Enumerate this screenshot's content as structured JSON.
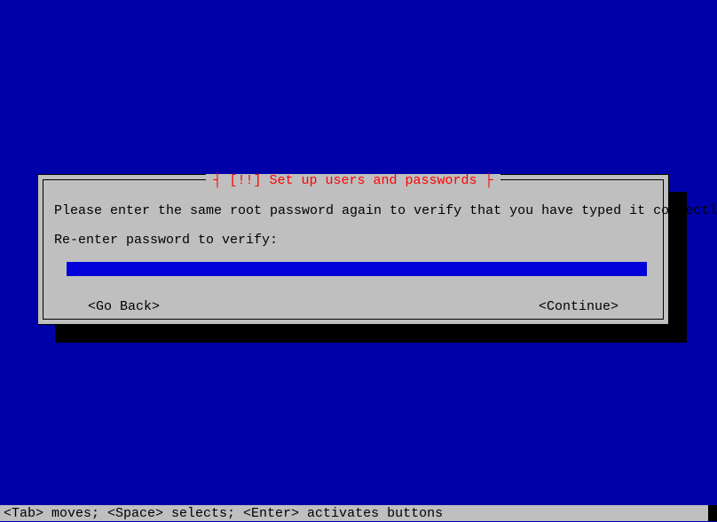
{
  "dialog": {
    "title_prefix": "┤ ",
    "title": "[!!] Set up users and passwords",
    "title_suffix": " ├",
    "instruction": "Please enter the same root password again to verify that you have typed it correctly.",
    "prompt": "Re-enter password to verify:",
    "password_value": "",
    "buttons": {
      "back": "<Go Back>",
      "continue": "<Continue>"
    }
  },
  "status_bar": "<Tab> moves; <Space> selects; <Enter> activates buttons"
}
